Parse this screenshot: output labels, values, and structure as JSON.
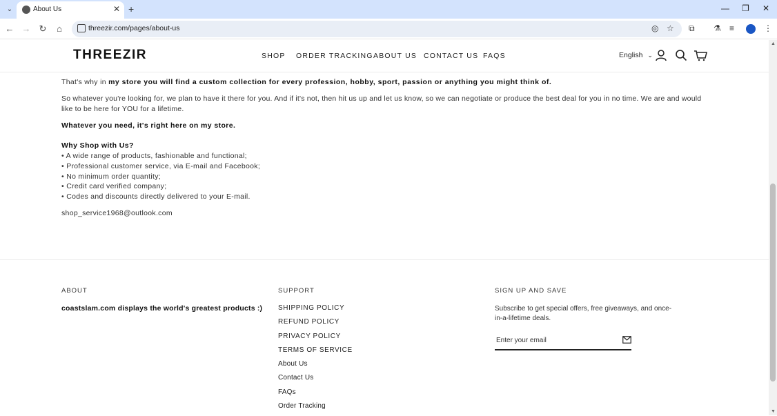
{
  "browser": {
    "tab_title": "About Us",
    "url": "threezir.com/pages/about-us",
    "new_tab_symbol": "+",
    "close_symbol": "✕"
  },
  "header": {
    "logo": "THREEZIR",
    "nav": [
      "SHOP",
      "ORDER TRACKING",
      "ABOUT US",
      "CONTACT US",
      "FAQS"
    ],
    "language": "English"
  },
  "content": {
    "p1_prefix": "That's why in ",
    "p1_bold": "my store you will find a custom collection for every profession, hobby, sport, passion or anything you might think of.",
    "p2": "So whatever you're looking for, we plan to have it there for you. And if it's not, then hit us up and let us know, so we can negotiate or produce the best deal for you in no time. We are and would like to be here for YOU for a lifetime.",
    "p3": "Whatever you need, it's right here on my store.",
    "why_title": "Why Shop with Us?",
    "bullets": [
      "• A wide range of products, fashionable and functional;",
      "• Professional customer service, via E-mail and Facebook;",
      "• No minimum order quantity;",
      "• Credit card verified company;",
      "• Codes and discounts directly delivered to your E-mail."
    ],
    "email": "shop_service1968@outlook.com"
  },
  "footer": {
    "about_heading": "ABOUT",
    "about_text": "coastslam.com displays the world's greatest products :)",
    "support_heading": "SUPPORT",
    "support_links": [
      "SHIPPING POLICY",
      "REFUND POLICY",
      "PRIVACY POLICY",
      "TERMS OF SERVICE",
      "About Us",
      "Contact Us",
      "FAQs",
      "Order Tracking"
    ],
    "signup_heading": "SIGN UP AND SAVE",
    "signup_text": "Subscribe to get special offers, free giveaways, and once-in-a-lifetime deals.",
    "email_placeholder": "Enter your email"
  },
  "colors": {
    "tabbar": "#d3e3fd",
    "text": "#222222",
    "profile": "#1a56c4"
  }
}
